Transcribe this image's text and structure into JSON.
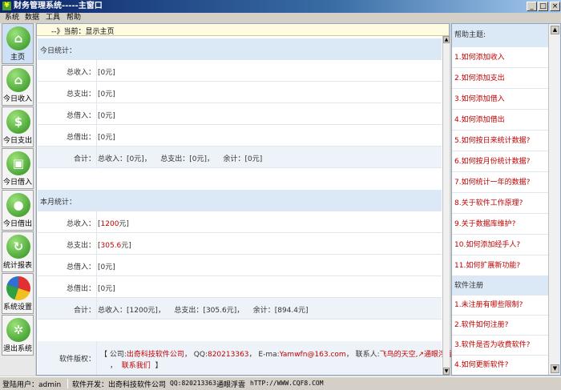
{
  "window": {
    "title": "财务管理系统-----主窗口",
    "app_icon": "¥",
    "minimize": "_",
    "maximize": "□",
    "close": "×"
  },
  "menu": [
    "系统",
    "数据",
    "工具",
    "帮助"
  ],
  "nav": [
    {
      "label": "主页",
      "icon": "home-icon",
      "glyph": "⌂"
    },
    {
      "label": "今日收入",
      "icon": "home-icon",
      "glyph": "⌂"
    },
    {
      "label": "今日支出",
      "icon": "dollar-icon",
      "glyph": "$"
    },
    {
      "label": "今日借入",
      "icon": "cart-icon",
      "glyph": "▣"
    },
    {
      "label": "今日借出",
      "icon": "user-icon",
      "glyph": "●"
    },
    {
      "label": "统计报表",
      "icon": "refresh-icon",
      "glyph": "↻"
    },
    {
      "label": "系统设置",
      "icon": "pie-chart-icon",
      "glyph": ""
    },
    {
      "label": "退出系统",
      "icon": "gear-icon",
      "glyph": "✲"
    }
  ],
  "crumb": "--》当前：显示主页",
  "today": {
    "title": "今日统计：",
    "rows": [
      {
        "label": "总收入：",
        "value": "[0元]"
      },
      {
        "label": "总支出：",
        "value": "[0元]"
      },
      {
        "label": "总借入：",
        "value": "[0元]"
      },
      {
        "label": "总借出：",
        "value": "[0元]"
      }
    ],
    "sum_label": "合计：",
    "sum": {
      "income_label": "总收入：",
      "income": "[0元]",
      "c1": "，",
      "expense_label": "总支出：",
      "expense": "[0元]",
      "c2": "，",
      "balance_label": "余计：",
      "balance": "[0元]"
    }
  },
  "month": {
    "title": "本月统计：",
    "rows": [
      {
        "label": "总收入：",
        "prefix": "[",
        "num": "1200",
        "suffix": "元]"
      },
      {
        "label": "总支出：",
        "prefix": "[",
        "num": "305.6",
        "suffix": "元]"
      },
      {
        "label": "总借入：",
        "prefix": "[",
        "num": "0",
        "suffix": "元]"
      },
      {
        "label": "总借出：",
        "prefix": "[",
        "num": "0",
        "suffix": "元]"
      }
    ],
    "sum_label": "合计：",
    "sum": {
      "income_label": "总收入：",
      "income": "[1200元]",
      "c1": "，",
      "expense_label": "总支出：",
      "expense": "[305.6元]",
      "c2": "，",
      "balance_label": "余计：",
      "balance": "[894.4元]"
    }
  },
  "copyright": {
    "label": "软件版权：",
    "line1_a": "【 公司:",
    "company": "出奇科技软件公司",
    "qq_label": "， QQ:",
    "qq": "820213363",
    "email_label": "， E-ma:",
    "email": "Yamwfn@163.com",
    "contact_label": "， 联系人:",
    "contact": "飞鸟的天空,↗通眼浮雲",
    "line2_sep": "，",
    "contact_link": "联系我们",
    "line2_end": "】"
  },
  "help": {
    "title": "帮助主题:",
    "items": [
      "1.如何添加收入",
      "2.如何添加支出",
      "3.如何添加借入",
      "4.如何添加借出",
      "5.如何按日来统计数据?",
      "6.如何按月份统计数据?",
      "7.如何统计一年的数据?",
      "8.关于软件工作原理?",
      "9.关于数据库维护?",
      "10.如何添加经手人?",
      "11.如何扩展新功能?"
    ],
    "reg_title": "软件注册",
    "reg_items": [
      "1.未注册有哪些限制?",
      "2.软件如何注册?",
      "3.软件是否为收费软件?",
      "4.如何更新软件?"
    ]
  },
  "status": {
    "user": "登陆用户：admin",
    "dev": "软件开发：出奇科技软件公司",
    "qq": "QQ:820213363",
    "name": "通眼浮雲",
    "url": "hTTP://WWW.CQF8.COM"
  }
}
